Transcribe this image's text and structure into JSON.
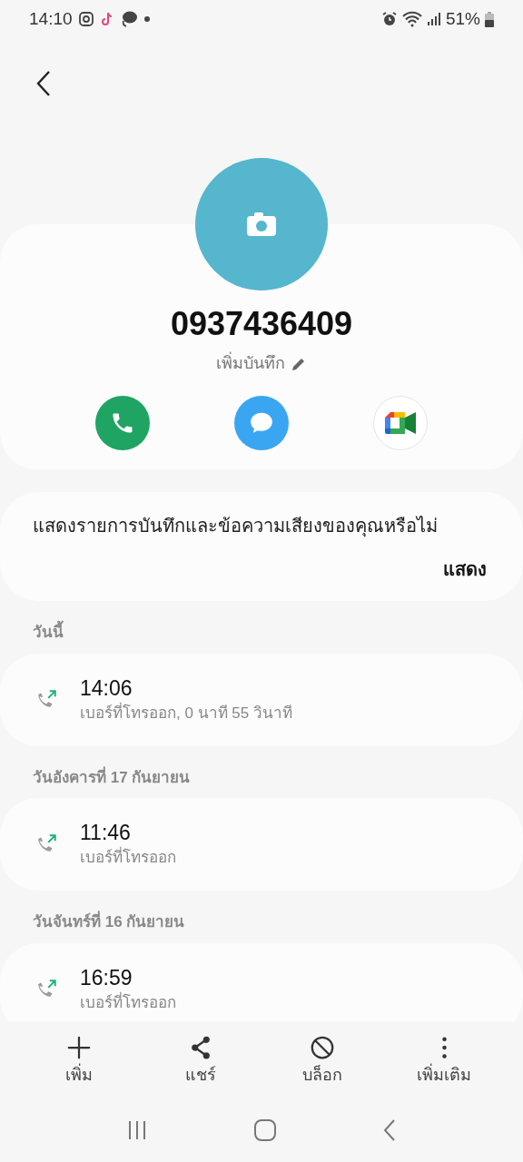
{
  "status_bar": {
    "time": "14:10",
    "battery": "51%"
  },
  "contact": {
    "number": "0937436409",
    "note_label": "เพิ่มบันทึก"
  },
  "actions": [
    {
      "kind": "call"
    },
    {
      "kind": "message"
    },
    {
      "kind": "video"
    }
  ],
  "banner": {
    "text": "แสดงรายการบันทึกและข้อความเสียงของคุณหรือไม่",
    "button": "แสดง"
  },
  "history": [
    {
      "date": "วันนี้",
      "calls": [
        {
          "time": "14:06",
          "detail": "เบอร์ที่โทรออก, 0 นาที 55 วินาที"
        }
      ]
    },
    {
      "date": "วันอังคารที่ 17 กันยายน",
      "calls": [
        {
          "time": "11:46",
          "detail": "เบอร์ที่โทรออก"
        }
      ]
    },
    {
      "date": "วันจันทร์ที่ 16 กันยายน",
      "calls": [
        {
          "time": "16:59",
          "detail": "เบอร์ที่โทรออก"
        }
      ]
    }
  ],
  "toolbar": [
    {
      "kind": "add",
      "label": "เพิ่ม"
    },
    {
      "kind": "share",
      "label": "แชร์"
    },
    {
      "kind": "block",
      "label": "บล็อก"
    },
    {
      "kind": "more",
      "label": "เพิ่มเติม"
    }
  ]
}
